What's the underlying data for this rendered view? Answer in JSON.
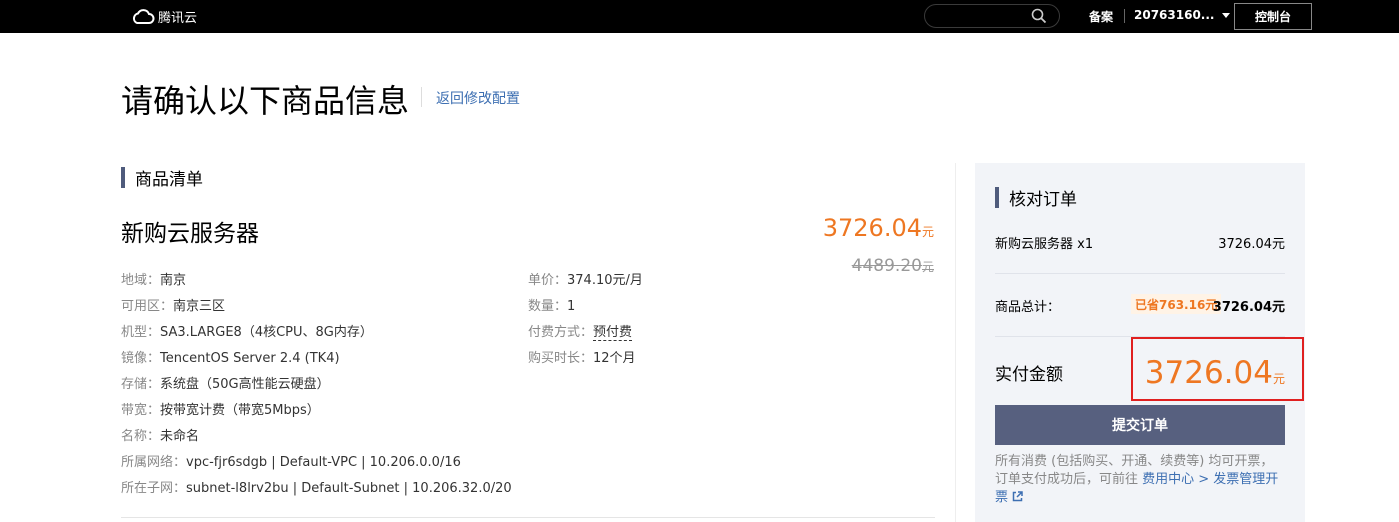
{
  "header": {
    "logo_text": "腾讯云",
    "filing": "备案",
    "account": "20763160...",
    "console_button": "控制台"
  },
  "page": {
    "title": "请确认以下商品信息",
    "back_link": "返回修改配置"
  },
  "product_list": {
    "heading": "商品清单",
    "name": "新购云服务器",
    "price": "3726.04",
    "price_unit": "元",
    "original_price": "4489.20",
    "original_unit": "元",
    "specs_left": [
      {
        "label": "地域：",
        "value": "南京"
      },
      {
        "label": "可用区：",
        "value": "南京三区"
      },
      {
        "label": "机型：",
        "value": "SA3.LARGE8（4核CPU、8G内存）"
      },
      {
        "label": "镜像：",
        "value": "TencentOS Server 2.4 (TK4)"
      },
      {
        "label": "存储：",
        "value": "系统盘（50G高性能云硬盘）"
      },
      {
        "label": "带宽：",
        "value": "按带宽计费（带宽5Mbps）"
      },
      {
        "label": "名称：",
        "value": "未命名"
      },
      {
        "label": "所属网络：",
        "value": "vpc-fjr6sdgb | Default-VPC | 10.206.0.0/16"
      },
      {
        "label": "所在子网：",
        "value": "subnet-l8lrv2bu | Default-Subnet | 10.206.32.0/20"
      }
    ],
    "specs_right": [
      {
        "label": "单价：",
        "value": "374.10元/月"
      },
      {
        "label": "数量：",
        "value": "1"
      },
      {
        "label": "付费方式：",
        "value": "预付费"
      },
      {
        "label": "购买时长：",
        "value": "12个月"
      }
    ]
  },
  "order": {
    "heading": "核对订单",
    "item_name": "新购云服务器 x1",
    "item_price": "3726.04元",
    "subtotal_label": "商品总计：",
    "saved_badge": "已省763.16元",
    "subtotal_value": "3726.04元",
    "total_label": "实付金额",
    "total_amount": "3726.04",
    "total_unit": "元",
    "submit_button": "提交订单",
    "notice_text": "所有消费 (包括购买、开通、续费等) 均可开票，订单支付成功后，可前往 ",
    "notice_link": "费用中心 > 发票管理开票"
  },
  "colors": {
    "price": "#ee7722",
    "link": "#3d6fb2",
    "button": "#57607f",
    "highlight_border": "#e02020"
  }
}
